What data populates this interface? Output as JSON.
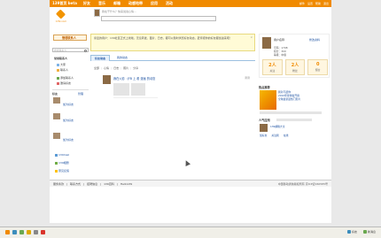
{
  "topnav": {
    "brand": "139首页 beta",
    "items": [
      "好友",
      "音乐",
      "邮箱",
      "动感地带",
      "应用",
      "活动"
    ],
    "right_links": [
      "邮件",
      "设置",
      "帮助",
      "退出"
    ]
  },
  "header": {
    "logo_text": "139.com",
    "mood_line": "我在干什么？快来说说心情..."
  },
  "sidebar": {
    "manage_button": "管理联系人",
    "search_placeholder": "搜索联系人",
    "groups_title": "常用联系人",
    "items": [
      "大家",
      "联系人",
      "添加联系人",
      "邀请好友"
    ],
    "friends_title": "好友",
    "friends_manage": "管理",
    "add_friend": "加为好友",
    "bottom_links": [
      "139mail",
      "139相册",
      "意见反馈"
    ]
  },
  "notice": {
    "text": "亲爱的用户：139社区正式上线啦，无论转发、图片、日志，都可以随时浏览好友动态，赶紧把你的好友都加进来吧！"
  },
  "tabs": [
    "好友动态",
    "我的动态"
  ],
  "filters": [
    "全部",
    "心情",
    "日志",
    "照片",
    "分享"
  ],
  "feed": {
    "text": "我在火影 《FB 上 看 漫画 的动态",
    "time": "刚刚"
  },
  "profile": {
    "edit_link": "修改资料",
    "name": "用户名称",
    "meta": [
      "号码：1708",
      "积分：300",
      "等级：中级"
    ],
    "stats": [
      {
        "value": "2人",
        "label": "关注"
      },
      {
        "value": "2人",
        "label": "粉丝"
      },
      {
        "value": "0",
        "label": "留言"
      }
    ]
  },
  "right_sections": {
    "recommend_title": "热点推荐",
    "recommend_lines": [
      "我对不起你",
      "2010年世博会开幕",
      "全球最新最热门影片"
    ],
    "popular_title": "人气应用",
    "popular_line": "139邮箱大全",
    "popular_links": [
      "加好友",
      "关注我",
      "在线"
    ]
  },
  "footer": {
    "links": [
      "服务条款",
      "联系方式",
      "招聘信息",
      "139百科",
      "Hello139"
    ],
    "copyright": "中国移动通信版权所有 京ICP证060585号"
  },
  "statusbar": {
    "right_items": [
      "好友",
      "新消息"
    ]
  },
  "colors": {
    "brand_orange": "#f08a00",
    "link_blue": "#1a4fa0",
    "notice_bg": "#fffbd6"
  }
}
